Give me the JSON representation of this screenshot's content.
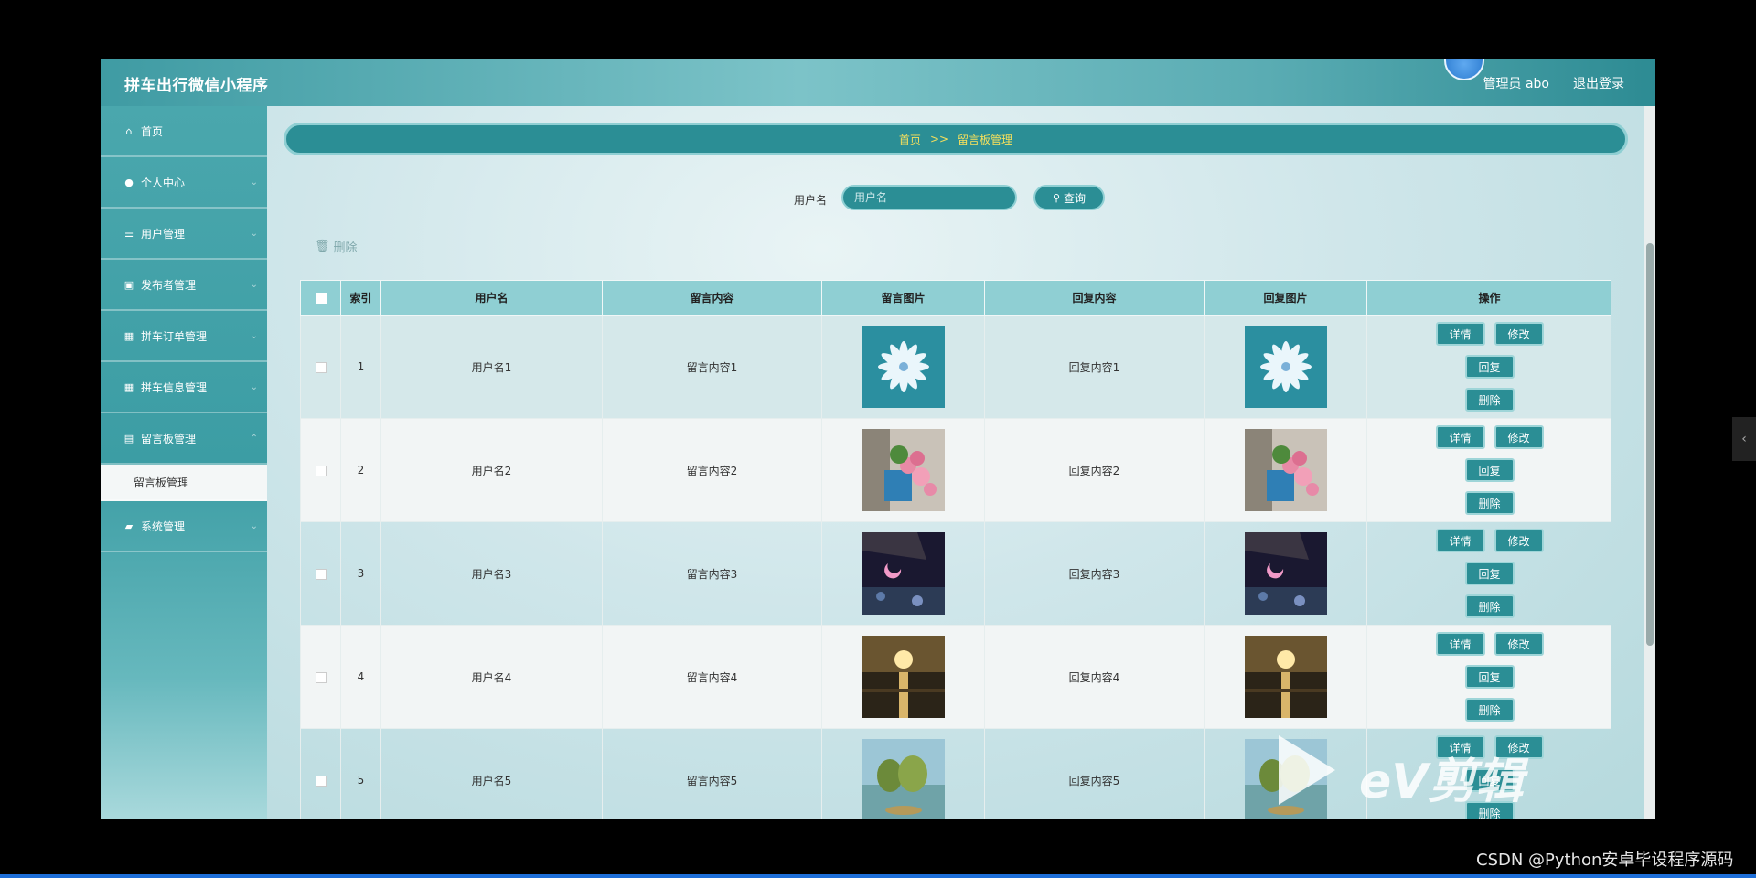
{
  "app": {
    "title": "拼车出行微信小程序"
  },
  "header": {
    "admin": "管理员 abo",
    "logout": "退出登录"
  },
  "sidebar": {
    "items": [
      {
        "label": "首页",
        "icon": "home-icon",
        "glyph": "⌂"
      },
      {
        "label": "个人中心",
        "icon": "user-icon",
        "glyph": "●"
      },
      {
        "label": "用户管理",
        "icon": "list-icon",
        "glyph": "☰"
      },
      {
        "label": "发布者管理",
        "icon": "clipboard-icon",
        "glyph": "▣"
      },
      {
        "label": "拼车订单管理",
        "icon": "grid-icon",
        "glyph": "▦"
      },
      {
        "label": "拼车信息管理",
        "icon": "grid-icon",
        "glyph": "▦"
      },
      {
        "label": "留言板管理",
        "icon": "message-icon",
        "glyph": "▤"
      },
      {
        "label": "系统管理",
        "icon": "settings-icon",
        "glyph": "▰"
      }
    ],
    "sub_item": "留言板管理"
  },
  "breadcrumb": {
    "home": "首页",
    "separator": ">>",
    "current": "留言板管理"
  },
  "search": {
    "label": "用户名",
    "placeholder": "用户名",
    "button": "查询"
  },
  "bulk_delete": "删除",
  "table": {
    "headers": [
      "索引",
      "用户名",
      "留言内容",
      "留言图片",
      "回复内容",
      "回复图片",
      "操作"
    ],
    "rows": [
      {
        "index": "1",
        "username": "用户名1",
        "content": "留言内容1",
        "reply": "回复内容1",
        "image": "white-flower"
      },
      {
        "index": "2",
        "username": "用户名2",
        "content": "留言内容2",
        "reply": "回复内容2",
        "image": "pink-roses"
      },
      {
        "index": "3",
        "username": "用户名3",
        "content": "留言内容3",
        "reply": "回复内容3",
        "image": "night-moon"
      },
      {
        "index": "4",
        "username": "用户名4",
        "content": "留言内容4",
        "reply": "回复内容4",
        "image": "sunset-sea"
      },
      {
        "index": "5",
        "username": "用户名5",
        "content": "留言内容5",
        "reply": "回复内容5",
        "image": "lake-trees"
      }
    ],
    "actions": {
      "detail": "详情",
      "edit": "修改",
      "reply": "回复",
      "delete": "删除"
    }
  },
  "overlay": {
    "watermark": "eV剪辑",
    "credit": "CSDN @Python安卓毕设程序源码"
  },
  "colors": {
    "accent": "#2b8e95",
    "accent_light": "#8fcfd3",
    "breadcrumb_text": "#f6e05c"
  }
}
